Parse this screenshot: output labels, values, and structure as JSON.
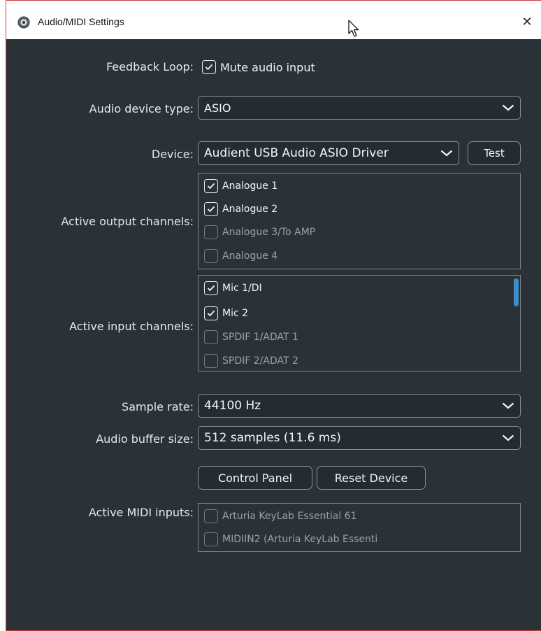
{
  "window": {
    "title": "Audio/MIDI Settings",
    "close_glyph": "✕",
    "app_icon": "speaker-globe-icon"
  },
  "feedback": {
    "label": "Feedback Loop:",
    "checkbox_label": "Mute audio input",
    "checked": true
  },
  "device_type": {
    "label": "Audio device type:",
    "value": "ASIO"
  },
  "device": {
    "label": "Device:",
    "value": "Audient USB Audio ASIO Driver",
    "test_label": "Test"
  },
  "output_channels": {
    "label": "Active output channels:",
    "items": [
      {
        "label": "Analogue 1",
        "checked": true
      },
      {
        "label": "Analogue 2",
        "checked": true
      },
      {
        "label": "Analogue 3/To AMP",
        "checked": false
      },
      {
        "label": "Analogue 4",
        "checked": false
      }
    ]
  },
  "input_channels": {
    "label": "Active input channels:",
    "items": [
      {
        "label": "Mic 1/DI",
        "checked": true
      },
      {
        "label": "Mic 2",
        "checked": true
      },
      {
        "label": "SPDIF 1/ADAT 1",
        "checked": false
      },
      {
        "label": "SPDIF 2/ADAT 2",
        "checked": false
      }
    ]
  },
  "sample_rate": {
    "label": "Sample rate:",
    "value": "44100 Hz"
  },
  "buffer_size": {
    "label": "Audio buffer size:",
    "value": "512 samples (11.6 ms)"
  },
  "buttons": {
    "control_panel": "Control Panel",
    "reset_device": "Reset Device"
  },
  "midi_inputs": {
    "label": "Active MIDI inputs:",
    "items": [
      {
        "label": "Arturia KeyLab Essential 61",
        "checked": false
      },
      {
        "label": "MIDIIN2 (Arturia KeyLab Essenti",
        "checked": false
      }
    ]
  },
  "colors": {
    "background": "#2b3237",
    "scrollbar": "#3d8ec9",
    "text": "#e6e9ec"
  }
}
